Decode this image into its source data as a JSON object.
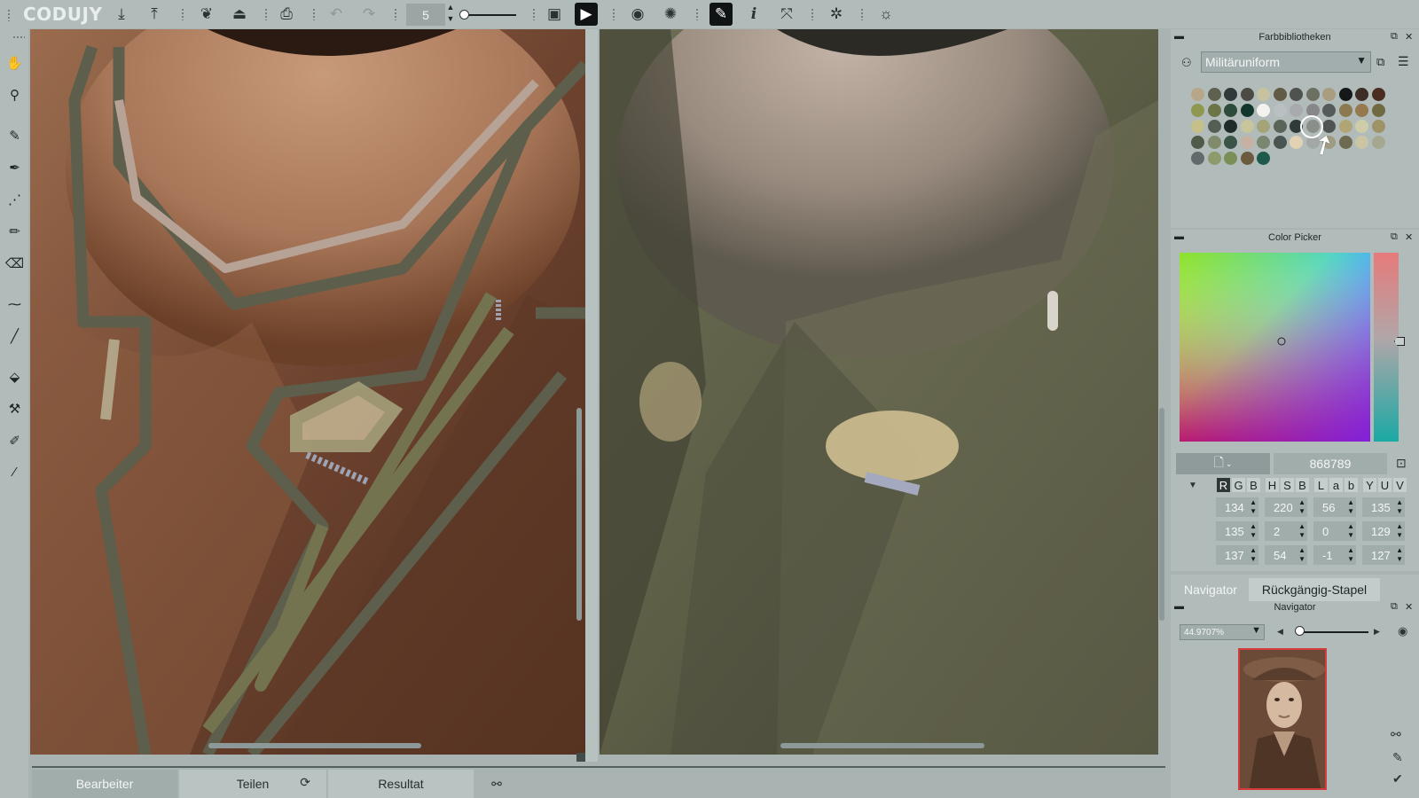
{
  "app": {
    "logo_text": "CODUJY",
    "brush_size": "5"
  },
  "toolbar": {
    "icons": [
      "import-icon",
      "export-icon",
      "color-fill-icon",
      "upload-icon",
      "print-icon",
      "undo-icon",
      "redo-icon",
      "play-film-icon",
      "play-icon",
      "eye-icon",
      "compare-icon",
      "brush-mode-icon",
      "info-icon",
      "fullscreen-icon",
      "settings-icon",
      "bug-icon"
    ]
  },
  "colors": {
    "accent": "#2e3636",
    "panel_bg": "#b1bbba",
    "field_bg": "#a1adab",
    "selected_color": "#868789",
    "nav_frame": "#d63b3b"
  },
  "library_panel": {
    "title": "Farbbibliotheken",
    "selected_library": "Militäruniform"
  },
  "color_picker_panel": {
    "title": "Color Picker",
    "hex_value": "868789",
    "groups": [
      {
        "letters": [
          "R",
          "G",
          "B"
        ]
      },
      {
        "letters": [
          "H",
          "S",
          "B"
        ]
      },
      {
        "letters": [
          "L",
          "a",
          "b"
        ]
      },
      {
        "letters": [
          "Y",
          "U",
          "V"
        ]
      }
    ],
    "rows": [
      [
        "134",
        "220",
        "56",
        "135"
      ],
      [
        "135",
        "2",
        "0",
        "129"
      ],
      [
        "137",
        "54",
        "-1",
        "127"
      ]
    ]
  },
  "navigator_panel": {
    "tabs": [
      "Navigator",
      "Rückgängig-Stapel"
    ],
    "title": "Navigator",
    "zoom": "44.9707%"
  },
  "bottom_tabs": {
    "edit": "Bearbeiter",
    "share": "Teilen",
    "result": "Resultat"
  }
}
